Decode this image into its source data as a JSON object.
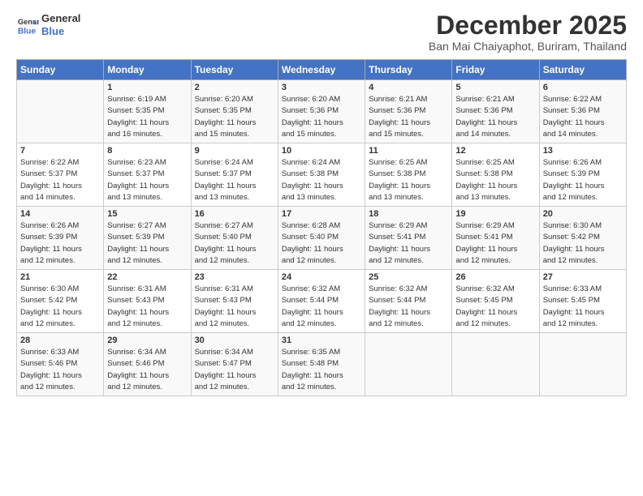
{
  "header": {
    "logo_line1": "General",
    "logo_line2": "Blue",
    "month_title": "December 2025",
    "location": "Ban Mai Chaiyaphot, Buriram, Thailand"
  },
  "days_of_week": [
    "Sunday",
    "Monday",
    "Tuesday",
    "Wednesday",
    "Thursday",
    "Friday",
    "Saturday"
  ],
  "weeks": [
    [
      {
        "day": "",
        "info": ""
      },
      {
        "day": "1",
        "info": "Sunrise: 6:19 AM\nSunset: 5:35 PM\nDaylight: 11 hours\nand 16 minutes."
      },
      {
        "day": "2",
        "info": "Sunrise: 6:20 AM\nSunset: 5:35 PM\nDaylight: 11 hours\nand 15 minutes."
      },
      {
        "day": "3",
        "info": "Sunrise: 6:20 AM\nSunset: 5:36 PM\nDaylight: 11 hours\nand 15 minutes."
      },
      {
        "day": "4",
        "info": "Sunrise: 6:21 AM\nSunset: 5:36 PM\nDaylight: 11 hours\nand 15 minutes."
      },
      {
        "day": "5",
        "info": "Sunrise: 6:21 AM\nSunset: 5:36 PM\nDaylight: 11 hours\nand 14 minutes."
      },
      {
        "day": "6",
        "info": "Sunrise: 6:22 AM\nSunset: 5:36 PM\nDaylight: 11 hours\nand 14 minutes."
      }
    ],
    [
      {
        "day": "7",
        "info": "Sunrise: 6:22 AM\nSunset: 5:37 PM\nDaylight: 11 hours\nand 14 minutes."
      },
      {
        "day": "8",
        "info": "Sunrise: 6:23 AM\nSunset: 5:37 PM\nDaylight: 11 hours\nand 13 minutes."
      },
      {
        "day": "9",
        "info": "Sunrise: 6:24 AM\nSunset: 5:37 PM\nDaylight: 11 hours\nand 13 minutes."
      },
      {
        "day": "10",
        "info": "Sunrise: 6:24 AM\nSunset: 5:38 PM\nDaylight: 11 hours\nand 13 minutes."
      },
      {
        "day": "11",
        "info": "Sunrise: 6:25 AM\nSunset: 5:38 PM\nDaylight: 11 hours\nand 13 minutes."
      },
      {
        "day": "12",
        "info": "Sunrise: 6:25 AM\nSunset: 5:38 PM\nDaylight: 11 hours\nand 13 minutes."
      },
      {
        "day": "13",
        "info": "Sunrise: 6:26 AM\nSunset: 5:39 PM\nDaylight: 11 hours\nand 12 minutes."
      }
    ],
    [
      {
        "day": "14",
        "info": "Sunrise: 6:26 AM\nSunset: 5:39 PM\nDaylight: 11 hours\nand 12 minutes."
      },
      {
        "day": "15",
        "info": "Sunrise: 6:27 AM\nSunset: 5:39 PM\nDaylight: 11 hours\nand 12 minutes."
      },
      {
        "day": "16",
        "info": "Sunrise: 6:27 AM\nSunset: 5:40 PM\nDaylight: 11 hours\nand 12 minutes."
      },
      {
        "day": "17",
        "info": "Sunrise: 6:28 AM\nSunset: 5:40 PM\nDaylight: 11 hours\nand 12 minutes."
      },
      {
        "day": "18",
        "info": "Sunrise: 6:29 AM\nSunset: 5:41 PM\nDaylight: 11 hours\nand 12 minutes."
      },
      {
        "day": "19",
        "info": "Sunrise: 6:29 AM\nSunset: 5:41 PM\nDaylight: 11 hours\nand 12 minutes."
      },
      {
        "day": "20",
        "info": "Sunrise: 6:30 AM\nSunset: 5:42 PM\nDaylight: 11 hours\nand 12 minutes."
      }
    ],
    [
      {
        "day": "21",
        "info": "Sunrise: 6:30 AM\nSunset: 5:42 PM\nDaylight: 11 hours\nand 12 minutes."
      },
      {
        "day": "22",
        "info": "Sunrise: 6:31 AM\nSunset: 5:43 PM\nDaylight: 11 hours\nand 12 minutes."
      },
      {
        "day": "23",
        "info": "Sunrise: 6:31 AM\nSunset: 5:43 PM\nDaylight: 11 hours\nand 12 minutes."
      },
      {
        "day": "24",
        "info": "Sunrise: 6:32 AM\nSunset: 5:44 PM\nDaylight: 11 hours\nand 12 minutes."
      },
      {
        "day": "25",
        "info": "Sunrise: 6:32 AM\nSunset: 5:44 PM\nDaylight: 11 hours\nand 12 minutes."
      },
      {
        "day": "26",
        "info": "Sunrise: 6:32 AM\nSunset: 5:45 PM\nDaylight: 11 hours\nand 12 minutes."
      },
      {
        "day": "27",
        "info": "Sunrise: 6:33 AM\nSunset: 5:45 PM\nDaylight: 11 hours\nand 12 minutes."
      }
    ],
    [
      {
        "day": "28",
        "info": "Sunrise: 6:33 AM\nSunset: 5:46 PM\nDaylight: 11 hours\nand 12 minutes."
      },
      {
        "day": "29",
        "info": "Sunrise: 6:34 AM\nSunset: 5:46 PM\nDaylight: 11 hours\nand 12 minutes."
      },
      {
        "day": "30",
        "info": "Sunrise: 6:34 AM\nSunset: 5:47 PM\nDaylight: 11 hours\nand 12 minutes."
      },
      {
        "day": "31",
        "info": "Sunrise: 6:35 AM\nSunset: 5:48 PM\nDaylight: 11 hours\nand 12 minutes."
      },
      {
        "day": "",
        "info": ""
      },
      {
        "day": "",
        "info": ""
      },
      {
        "day": "",
        "info": ""
      }
    ]
  ]
}
